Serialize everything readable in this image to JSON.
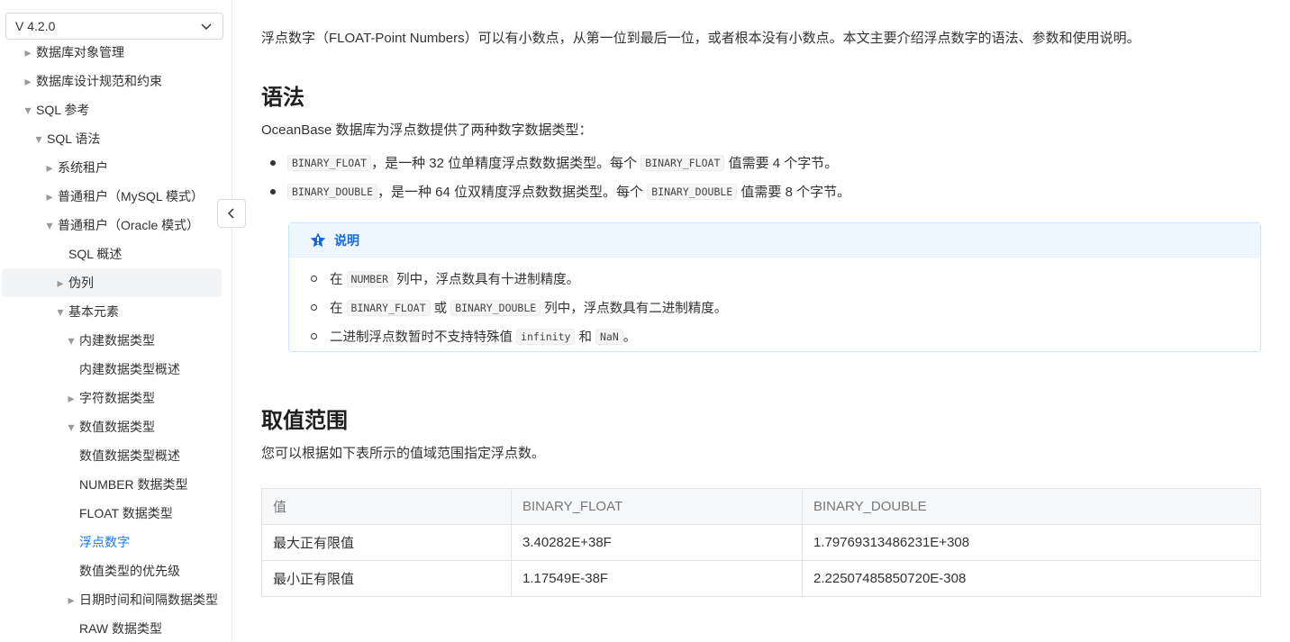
{
  "sidebar": {
    "version": "V 4.2.0",
    "items": [
      {
        "label": "数据库对象管理",
        "arrow": "right"
      },
      {
        "label": "数据库设计规范和约束",
        "arrow": "right"
      },
      {
        "label": "SQL 参考",
        "arrow": "down"
      },
      {
        "label": "SQL 语法",
        "arrow": "down"
      },
      {
        "label": "系统租户",
        "arrow": "right"
      },
      {
        "label": "普通租户（MySQL 模式）",
        "arrow": "right"
      },
      {
        "label": "普通租户（Oracle 模式）",
        "arrow": "down"
      },
      {
        "label": "SQL 概述",
        "arrow": ""
      },
      {
        "label": "伪列",
        "arrow": "right"
      },
      {
        "label": "基本元素",
        "arrow": "down"
      },
      {
        "label": "内建数据类型",
        "arrow": "down"
      },
      {
        "label": "内建数据类型概述",
        "arrow": ""
      },
      {
        "label": "字符数据类型",
        "arrow": "right"
      },
      {
        "label": "数值数据类型",
        "arrow": "down"
      },
      {
        "label": "数值数据类型概述",
        "arrow": ""
      },
      {
        "label": "NUMBER 数据类型",
        "arrow": ""
      },
      {
        "label": "FLOAT 数据类型",
        "arrow": ""
      },
      {
        "label": "浮点数字",
        "arrow": ""
      },
      {
        "label": "数值类型的优先级",
        "arrow": ""
      },
      {
        "label": "日期时间和间隔数据类型",
        "arrow": "right"
      },
      {
        "label": "RAW 数据类型",
        "arrow": ""
      }
    ]
  },
  "content": {
    "intro": "浮点数字（FLOAT-Point Numbers）可以有小数点，从第一位到最后一位，或者根本没有小数点。本文主要介绍浮点数字的语法、参数和使用说明。",
    "syntax_heading": "语法",
    "syntax_para": "OceanBase 数据库为浮点数提供了两种数字数据类型：",
    "bullets": [
      {
        "code1": "BINARY_FLOAT",
        "text1": "，是一种 32 位单精度浮点数数据类型。每个",
        "code2": "BINARY_FLOAT",
        "text2": "值需要 4 个字节。"
      },
      {
        "code1": "BINARY_DOUBLE",
        "text1": "，是一种 64 位双精度浮点数数据类型。每个",
        "code2": "BINARY_DOUBLE",
        "text2": "值需要 8 个字节。"
      }
    ],
    "note": {
      "title": "说明",
      "item1": {
        "pre": "在",
        "code": "NUMBER",
        "post": "列中，浮点数具有十进制精度。"
      },
      "item2": {
        "pre": "在",
        "code1": "BINARY_FLOAT",
        "mid": "或",
        "code2": "BINARY_DOUBLE",
        "post": "列中，浮点数具有二进制精度。"
      },
      "item3": {
        "pre": "二进制浮点数暂时不支持特殊值",
        "code1": "infinity",
        "mid": "和",
        "code2": "NaN",
        "post": "。"
      }
    },
    "range_heading": "取值范围",
    "range_para": "您可以根据如下表所示的值域范围指定浮点数。",
    "table": {
      "headers": [
        "值",
        "BINARY_FLOAT",
        "BINARY_DOUBLE"
      ],
      "rows": [
        [
          "最大正有限值",
          "3.40282E+38F",
          "1.79769313486231E+308"
        ],
        [
          "最小正有限值",
          "1.17549E-38F",
          "2.22507485850720E-308"
        ]
      ]
    }
  },
  "colors": {
    "accent": "#1677ff",
    "note_bg": "#eef6ff",
    "note_border": "#cde3fb"
  }
}
